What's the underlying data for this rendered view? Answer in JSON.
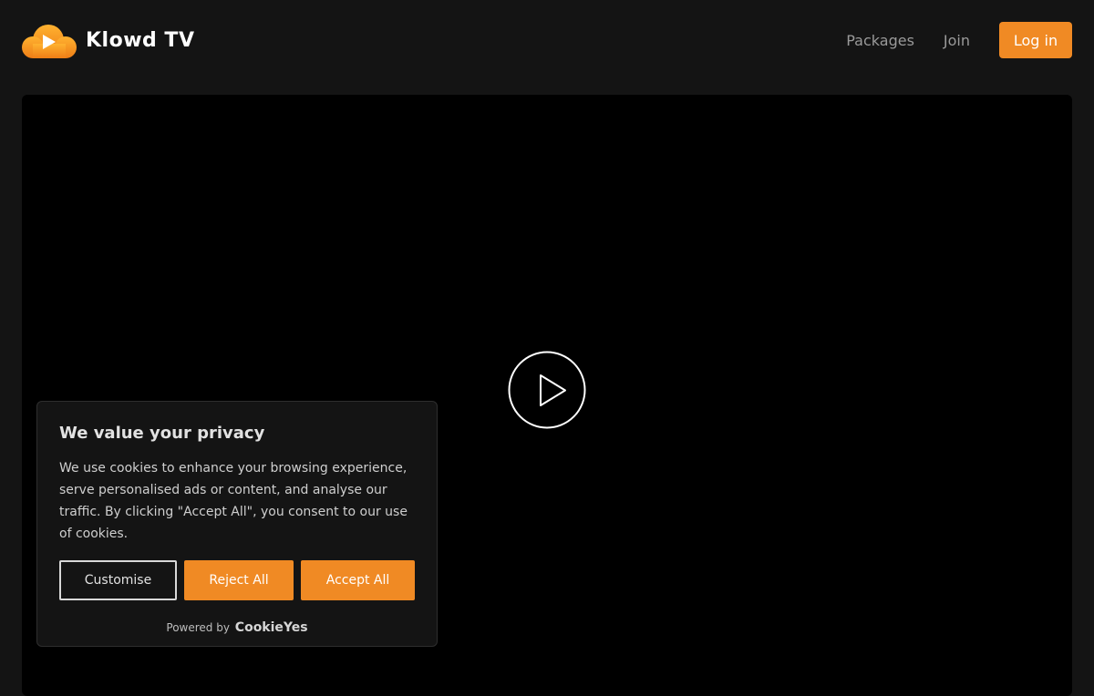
{
  "header": {
    "brand": "Klowd TV",
    "logo_icon": "cloud-play-icon",
    "nav": [
      {
        "label": "Packages"
      },
      {
        "label": "Join"
      }
    ],
    "login_label": "Log in"
  },
  "player": {
    "play_icon": "play-icon"
  },
  "cookie_banner": {
    "title": "We value your privacy",
    "text": "We use cookies to enhance your browsing experience, serve personalised ads or content, and analyse our traffic. By clicking \"Accept All\", you consent to our use of cookies.",
    "customise_label": "Customise",
    "reject_label": "Reject All",
    "accept_label": "Accept All",
    "powered_by": "Powered by",
    "powered_brand": "CookieYes"
  },
  "colors": {
    "accent": "#f08a24",
    "background": "#141414",
    "player": "#000000"
  }
}
